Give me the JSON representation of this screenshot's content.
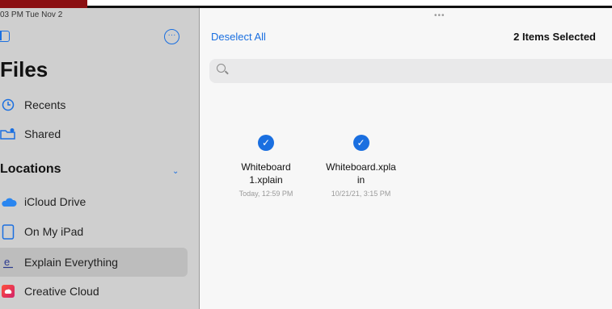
{
  "status": {
    "time_date": "03 PM  Tue Nov 2"
  },
  "sidebar": {
    "title": "Files",
    "recents": "Recents",
    "shared": "Shared",
    "locations_header": "Locations",
    "locations": [
      {
        "label": "iCloud Drive",
        "icon": "cloud-icon"
      },
      {
        "label": "On My iPad",
        "icon": "ipad-icon"
      },
      {
        "label": "Explain Everything",
        "icon": "explain-everything-icon"
      },
      {
        "label": "Creative Cloud",
        "icon": "creative-cloud-icon"
      }
    ]
  },
  "main": {
    "deselect_label": "Deselect All",
    "selected_count": "2 Items Selected",
    "files": [
      {
        "name_line1": "Whiteboard",
        "name_line2": "1.xplain",
        "date": "Today, 12:59 PM",
        "selected": true
      },
      {
        "name_line1": "Whiteboard.xpla",
        "name_line2": "in",
        "date": "10/21/21, 3:15 PM",
        "selected": true
      }
    ]
  },
  "colors": {
    "accent": "#1a6fe0",
    "sidebar_bg": "#cfcfcf",
    "main_bg": "#f7f7f7",
    "red_tab": "#8b0f12"
  }
}
